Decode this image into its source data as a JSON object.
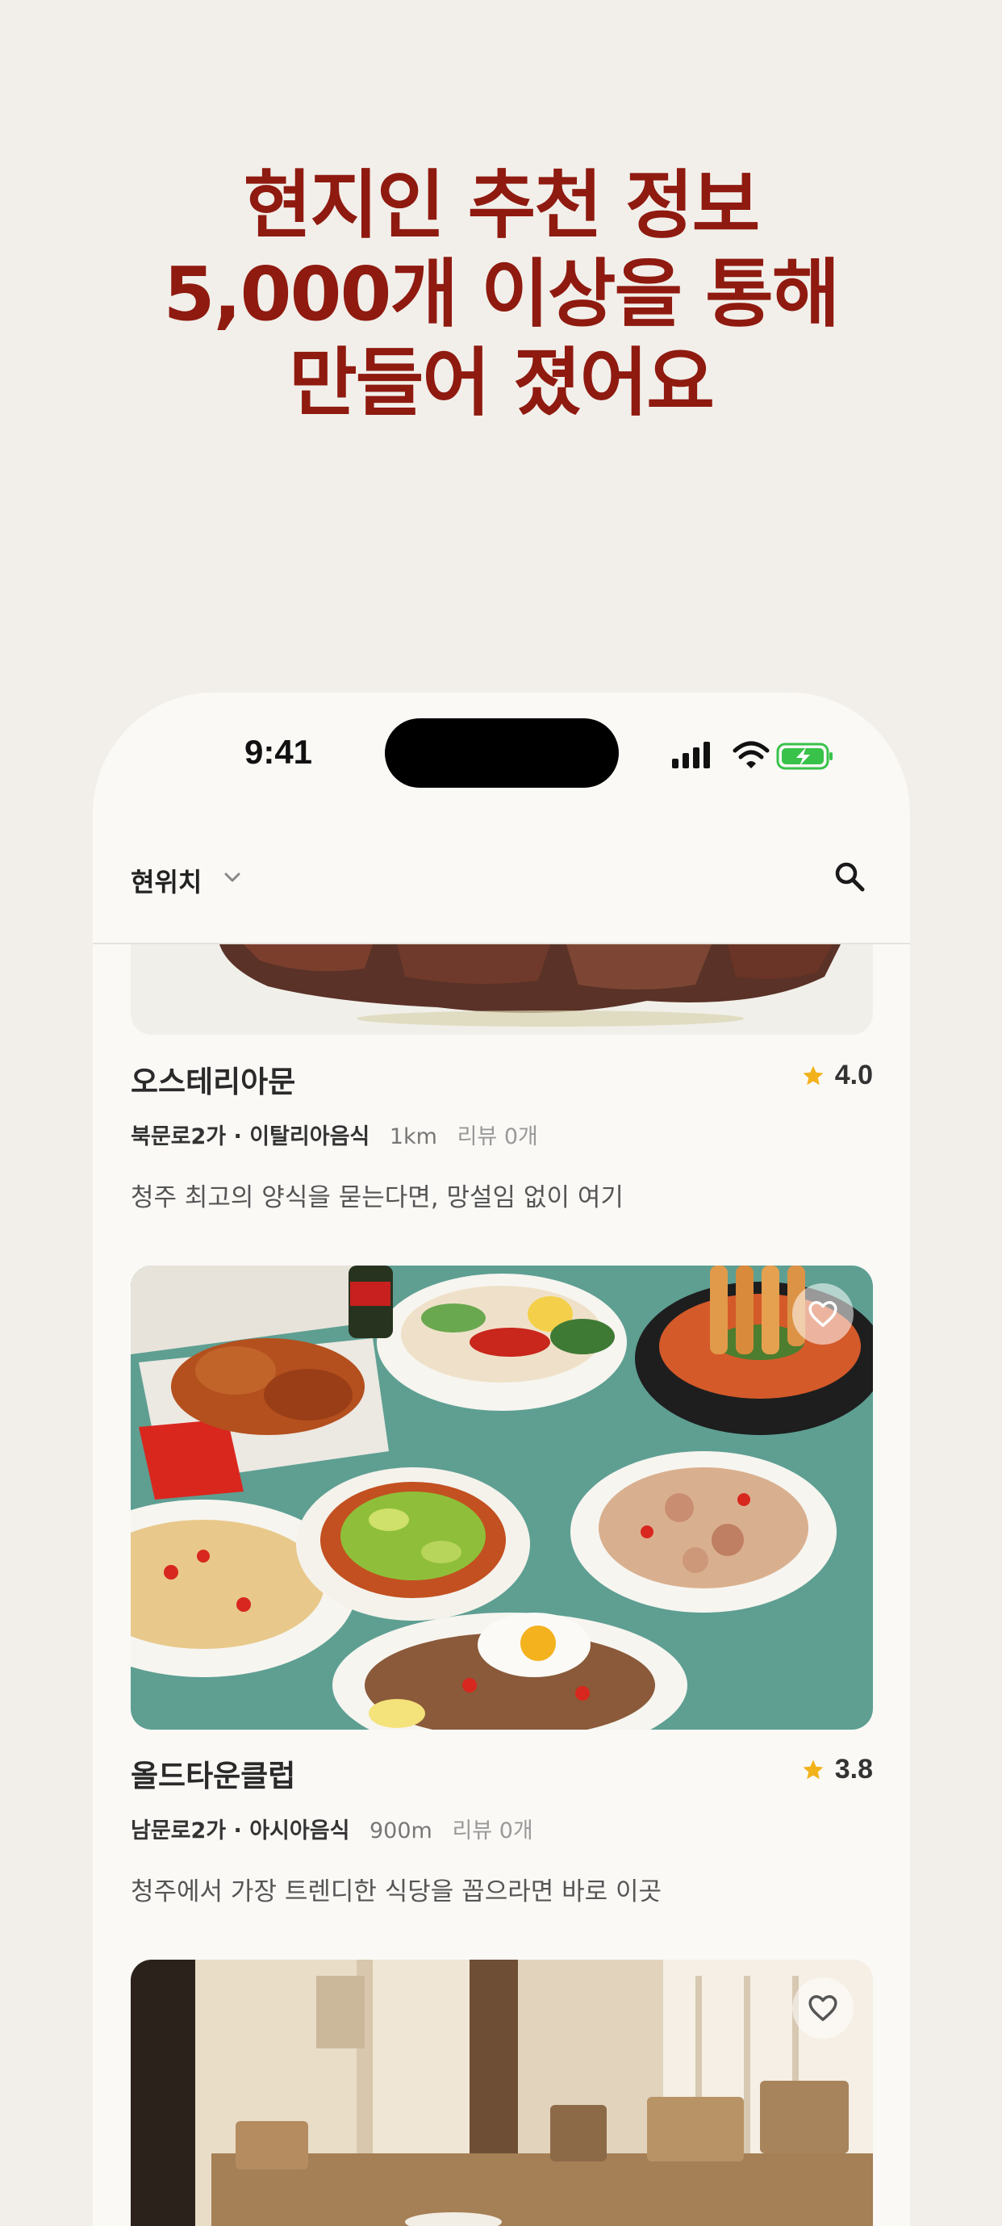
{
  "headline": {
    "line1": "현지인 추천 정보",
    "line2": "5,000개 이상을 통해",
    "line3": "만들어 졌어요"
  },
  "status_bar": {
    "time": "9:41"
  },
  "app_bar": {
    "location_label": "현위치",
    "location_chevron": "chevron-down-icon",
    "search_icon": "search-icon"
  },
  "restaurants": [
    {
      "name": "오스테리아문",
      "rating": "4.0",
      "location": "북문로2가 · 이탈리아음식",
      "distance": "1km",
      "reviews": "리뷰 0개",
      "description": "청주 최고의 양식을 묻는다면, 망설임 없이 여기"
    },
    {
      "name": "올드타운클럽",
      "rating": "3.8",
      "location": "남문로2가 · 아시아음식",
      "distance": "900m",
      "reviews": "리뷰 0개",
      "description": "청주에서 가장 트렌디한 식당을 꼽으라면 바로 이곳"
    }
  ],
  "colors": {
    "headline": "#8f1a10",
    "background": "#f2efea",
    "star": "#f2b21b",
    "battery": "#39c24a"
  }
}
